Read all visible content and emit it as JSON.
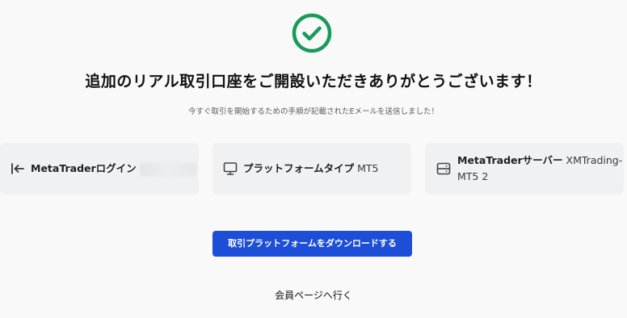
{
  "success": {
    "icon": "check-circle-icon",
    "color": "#179a5a"
  },
  "headline": "追加のリアル取引口座をご開設いただきありがとうございます！",
  "subtext": "今すぐ取引を開始するための手順が記載されたEメールを送信しました！",
  "cards": {
    "login": {
      "icon": "login-arrow-icon",
      "label": "MetaTraderログイン",
      "value": ""
    },
    "platform": {
      "icon": "monitor-icon",
      "label": "プラットフォームタイプ",
      "value": "MT5"
    },
    "server": {
      "icon": "server-icon",
      "label": "MetaTraderサーバー",
      "value_line1": "XMTrading-",
      "value_line2": "MT5 2"
    }
  },
  "download_button": "取引プラットフォームをダウンロードする",
  "member_link": "会員ページへ行く",
  "colors": {
    "accent": "#1d4ed8",
    "success": "#179a5a",
    "card_bg": "#f0f1f3",
    "page_bg": "#f9f9fa"
  }
}
